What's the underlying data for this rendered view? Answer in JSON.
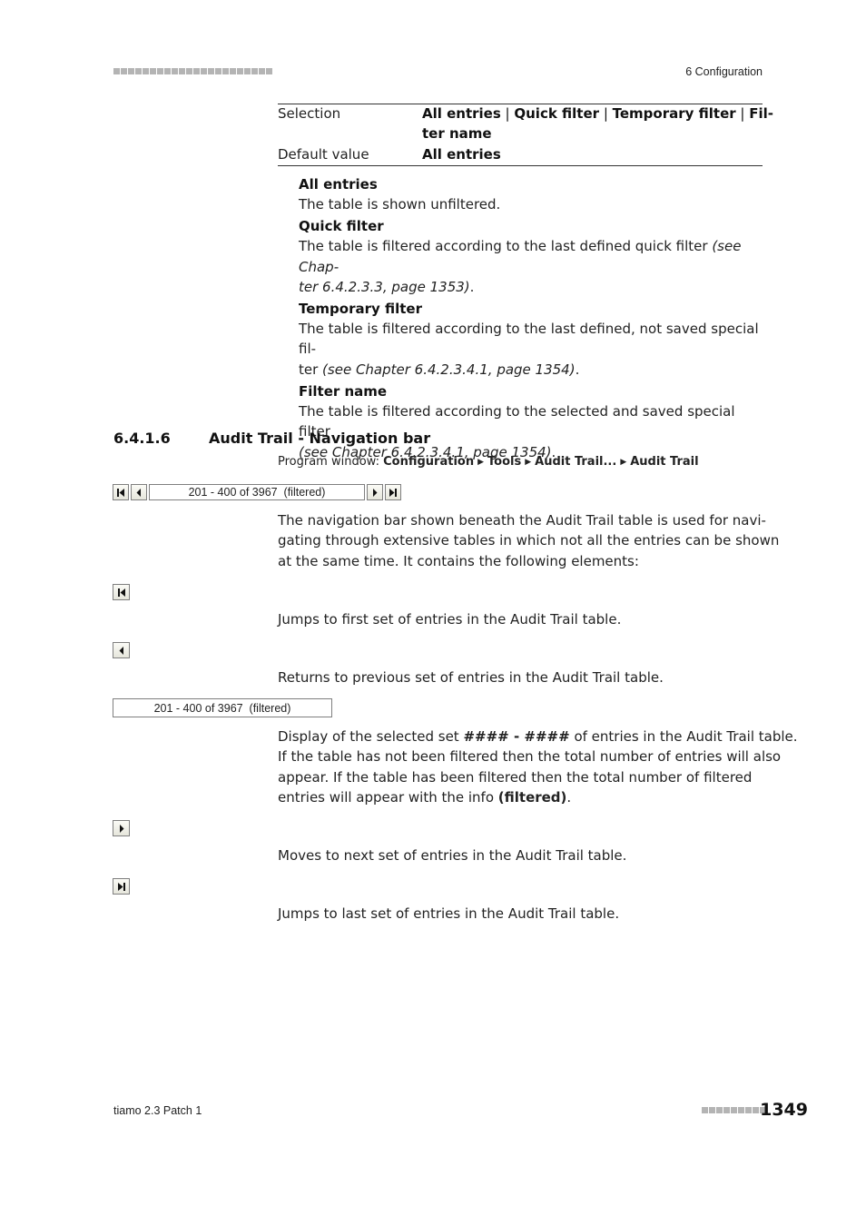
{
  "header": {
    "chapter": "6 Configuration",
    "decor_squares": 22
  },
  "param_table": {
    "rows": [
      {
        "label": "Selection",
        "value_parts": [
          "All entries",
          "Quick filter",
          "Temporary filter",
          "Fil-"
        ],
        "value_cont": "ter name"
      },
      {
        "label": "Default value",
        "value": "All entries"
      }
    ]
  },
  "options": [
    {
      "term": "All entries",
      "desc_lines": [
        {
          "text": "The table is shown unfiltered.",
          "ref": ""
        }
      ]
    },
    {
      "term": "Quick filter",
      "desc_lines": [
        {
          "text": "The table is filtered according to the last defined quick filter ",
          "ref": "(see Chap-"
        },
        {
          "text": "",
          "ref": "ter 6.4.2.3.3, page 1353)",
          "tail": "."
        }
      ]
    },
    {
      "term": "Temporary filter",
      "desc_lines": [
        {
          "text": "The table is filtered according to the last defined, not saved special fil-",
          "ref": ""
        },
        {
          "text": "ter ",
          "ref": "(see Chapter 6.4.2.3.4.1, page 1354)",
          "tail": "."
        }
      ]
    },
    {
      "term": "Filter name",
      "desc_lines": [
        {
          "text": "The table is filtered according to the selected and saved special filter",
          "ref": ""
        },
        {
          "text": "",
          "ref": "(see Chapter 6.4.2.3.4.1, page 1354)",
          "tail": "."
        }
      ]
    }
  ],
  "section": {
    "number": "6.4.1.6",
    "title": "Audit Trail - Navigation bar",
    "program_window_label": "Program window:",
    "path": [
      "Configuration",
      "Tools",
      "Audit Trail...",
      "Audit Trail"
    ]
  },
  "navbar": {
    "display_text": "201 - 400 of 3967  (filtered)"
  },
  "intro_lines": [
    "The navigation bar shown beneath the Audit Trail table is used for navi-",
    "gating through extensive tables in which not all the entries can be shown",
    "at the same time. It contains the following elements:"
  ],
  "elements": {
    "first": "Jumps to first set of entries in the Audit Trail table.",
    "previous": "Returns to previous set of entries in the Audit Trail table.",
    "display_text": "201 - 400 of 3967  (filtered)",
    "display_desc": {
      "l1_a": "Display of the selected set ",
      "l1_b": "#### - ####",
      "l1_c": " of entries in the Audit Trail table.",
      "l2": "If the table has not been filtered then the total number of entries will also",
      "l3": "appear. If the table has been filtered then the total number of filtered",
      "l4_a": "entries will appear with the info ",
      "l4_b": "(filtered)",
      "l4_c": "."
    },
    "next": "Moves to next set of entries in the Audit Trail table.",
    "last": "Jumps to last set of entries in the Audit Trail table."
  },
  "footer": {
    "product": "tiamo 2.3 Patch 1",
    "page": "1349",
    "decor_squares": 9
  }
}
